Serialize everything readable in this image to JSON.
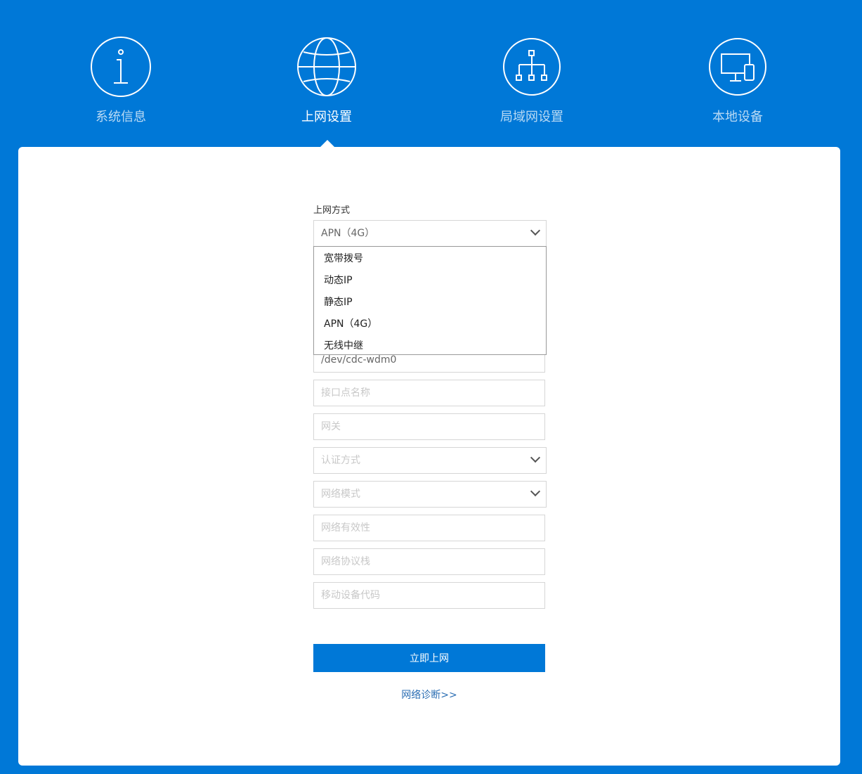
{
  "nav": {
    "items": [
      {
        "label": "系统信息",
        "icon": "info-icon"
      },
      {
        "label": "上网设置",
        "icon": "globe-icon"
      },
      {
        "label": "局域网设置",
        "icon": "network-tree-icon"
      },
      {
        "label": "本地设备",
        "icon": "devices-icon"
      }
    ],
    "active": "上网设置"
  },
  "form": {
    "mode_label": "上网方式",
    "mode_value": "APN（4G）",
    "mode_options": [
      "宽带拨号",
      "动态IP",
      "静态IP",
      "APN（4G）",
      "无线中继"
    ],
    "device_value": "/dev/cdc-wdm0",
    "apn_placeholder": "接口点名称",
    "gateway_placeholder": "网关",
    "auth_placeholder": "认证方式",
    "netmode_placeholder": "网络模式",
    "validity_placeholder": "网络有效性",
    "protocol_placeholder": "网络协议栈",
    "mobile_code_placeholder": "移动设备代码",
    "submit_label": "立即上网",
    "diagnose_link": "网络诊断>>"
  },
  "colors": {
    "brand_blue": "#0078d7",
    "link_blue": "#2a6db3"
  }
}
